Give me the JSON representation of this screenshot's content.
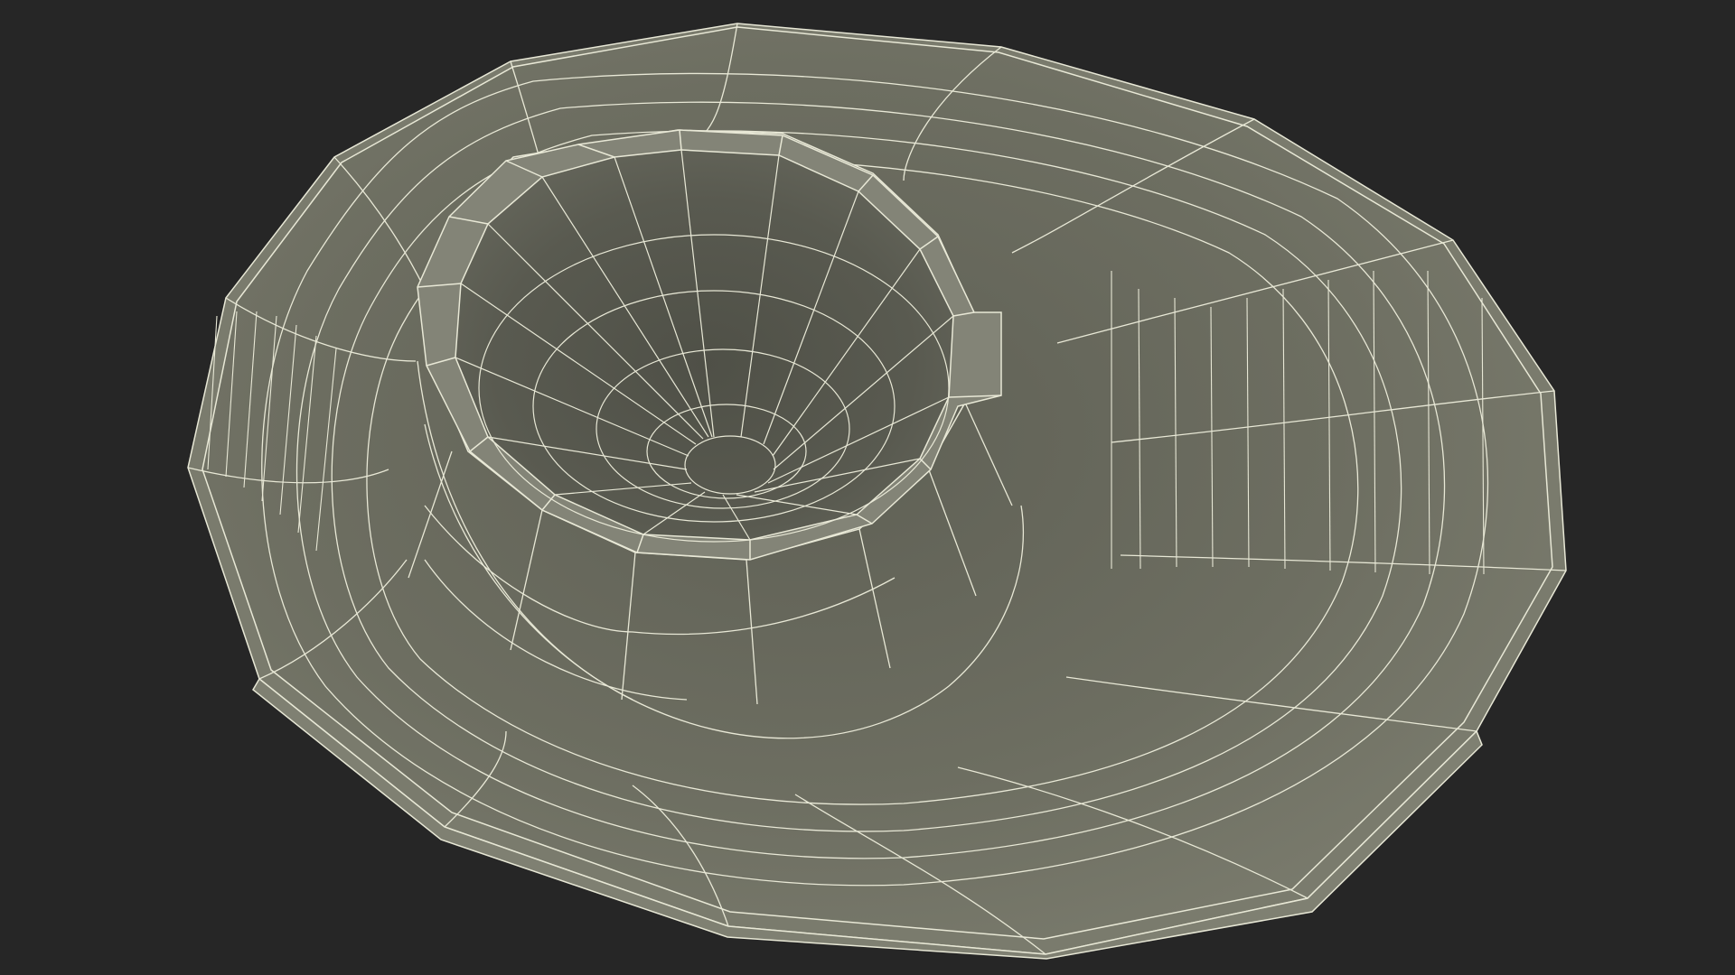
{
  "scene": {
    "background_color": "#262626",
    "surface_color": "#6e6f62",
    "surface_light_color": "#7c7d6f",
    "surface_dark_color": "#55564c",
    "wire_color": "#e8e8d6",
    "render_mode": "wireframe-on-shaded",
    "subject": "dish-with-cup-well"
  }
}
